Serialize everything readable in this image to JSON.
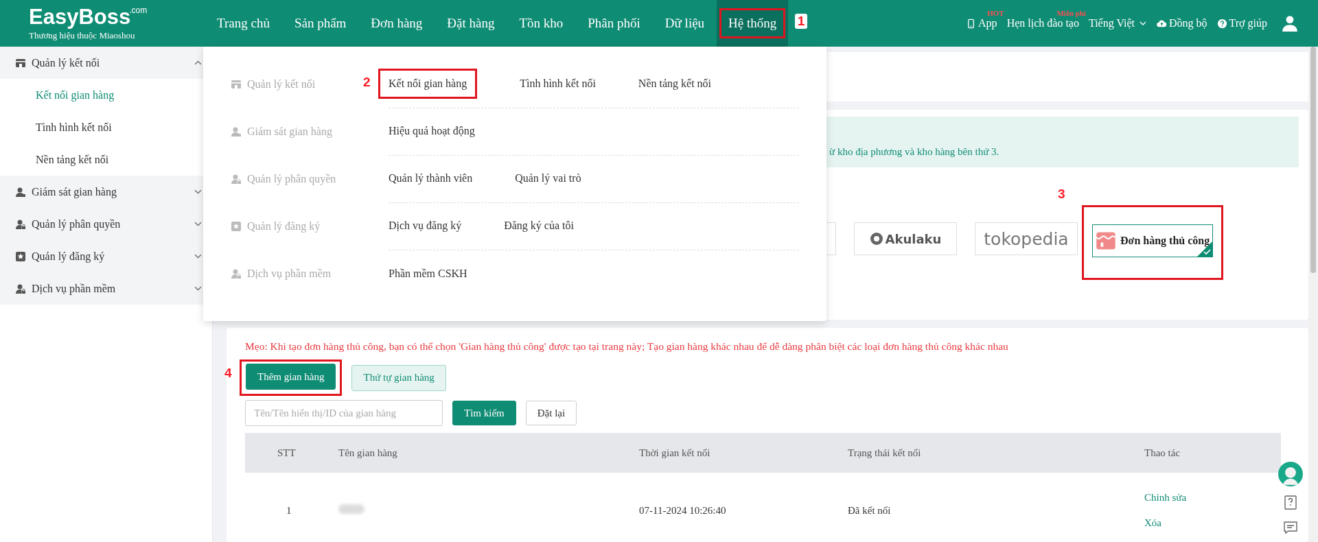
{
  "header": {
    "logo": "EasyBoss",
    "logo_suffix": ".com",
    "tagline": "Thương hiệu thuộc Miaoshou",
    "nav": [
      {
        "label": "Trang chủ",
        "selected": false
      },
      {
        "label": "Sản phẩm",
        "selected": false
      },
      {
        "label": "Đơn hàng",
        "selected": false
      },
      {
        "label": "Đặt hàng",
        "selected": false
      },
      {
        "label": "Tồn kho",
        "selected": false
      },
      {
        "label": "Phân phối",
        "selected": false
      },
      {
        "label": "Dữ liệu",
        "selected": false
      },
      {
        "label": "Hệ thống",
        "selected": true,
        "annotation": "1"
      }
    ],
    "tools": [
      {
        "kind": "phone",
        "label": "App",
        "badge": "HOT"
      },
      {
        "kind": "plain",
        "label": "Hẹn lịch đào tạo",
        "badge": "Miễn phí"
      },
      {
        "kind": "language",
        "label": "Tiếng Việt"
      },
      {
        "kind": "cloud",
        "label": "Đồng bộ"
      },
      {
        "kind": "help",
        "label": "Trợ giúp"
      },
      {
        "kind": "user"
      }
    ]
  },
  "sidebar": [
    {
      "kind": "store",
      "label": "Quản lý kết nối",
      "expanded": true,
      "children": [
        {
          "label": "Kết nối gian hàng",
          "selected": true
        },
        {
          "label": "Tình hình kết nối",
          "selected": false
        },
        {
          "label": "Nền tảng kết nối",
          "selected": false
        }
      ]
    },
    {
      "kind": "person",
      "label": "Giám sát gian hàng",
      "expanded": false
    },
    {
      "kind": "lock",
      "label": "Quản lý phân quyền",
      "expanded": false
    },
    {
      "kind": "star",
      "label": "Quản lý đăng ký",
      "expanded": false
    },
    {
      "kind": "lock",
      "label": "Dịch vụ phần mềm",
      "expanded": false
    }
  ],
  "mega_menu": [
    {
      "kind": "store",
      "label": "Quản lý kết nối",
      "links": [
        {
          "label": "Kết nối gian hàng",
          "annotation": "2"
        },
        {
          "label": "Tình hình kết nối"
        },
        {
          "label": "Nền tảng kết nối"
        }
      ]
    },
    {
      "kind": "person",
      "label": "Giám sát gian hàng",
      "links": [
        {
          "label": "Hiệu quả hoạt động"
        }
      ]
    },
    {
      "kind": "lock",
      "label": "Quản lý phân quyền",
      "links": [
        {
          "label": "Quản lý thành viên"
        },
        {
          "label": "Quản lý vai trò"
        }
      ]
    },
    {
      "kind": "star",
      "label": "Quản lý đăng ký",
      "links": [
        {
          "label": "Dịch vụ đăng ký"
        },
        {
          "label": "Đăng ký của tôi"
        }
      ]
    },
    {
      "kind": "lock",
      "label": "Dịch vụ phần mềm",
      "links": [
        {
          "label": "Phần mềm CSKH"
        }
      ]
    }
  ],
  "notice": "ừ kho địa phương và kho hàng bên thứ 3.",
  "platforms": [
    {
      "kind": "akulaku",
      "label": "Akulaku",
      "selected": false
    },
    {
      "kind": "tokopedia",
      "label": "tokopedia",
      "selected": false
    },
    {
      "kind": "manual",
      "label": "Đơn hàng thủ công",
      "selected": true,
      "annotation": "3"
    }
  ],
  "tip": "Mẹo: Khi tạo đơn hàng thủ công, bạn có thể chọn 'Gian hàng thủ công' được tạo tại trang này; Tạo gian hàng khác nhau để dễ dàng phân biệt các loại đơn hàng thủ công khác nhau",
  "buttons": [
    {
      "kind": "primary",
      "label": "Thêm gian hàng",
      "annotation": "4"
    },
    {
      "kind": "light",
      "label": "Thứ tự gian hàng"
    }
  ],
  "search": {
    "placeholder": "Tên/Tên hiển thị/ID của gian hàng",
    "submit": "Tìm kiếm",
    "reset": "Đặt lại"
  },
  "table": {
    "columns": [
      "STT",
      "Tên gian hàng",
      "Thời gian kết nối",
      "Trạng thái kết nối",
      "Thao tác"
    ],
    "rows": [
      {
        "index": "1",
        "time": "07-11-2024 10:26:40",
        "status": "Đã kết nối",
        "actions": [
          "Chỉnh sửa",
          "Xóa"
        ]
      }
    ]
  }
}
